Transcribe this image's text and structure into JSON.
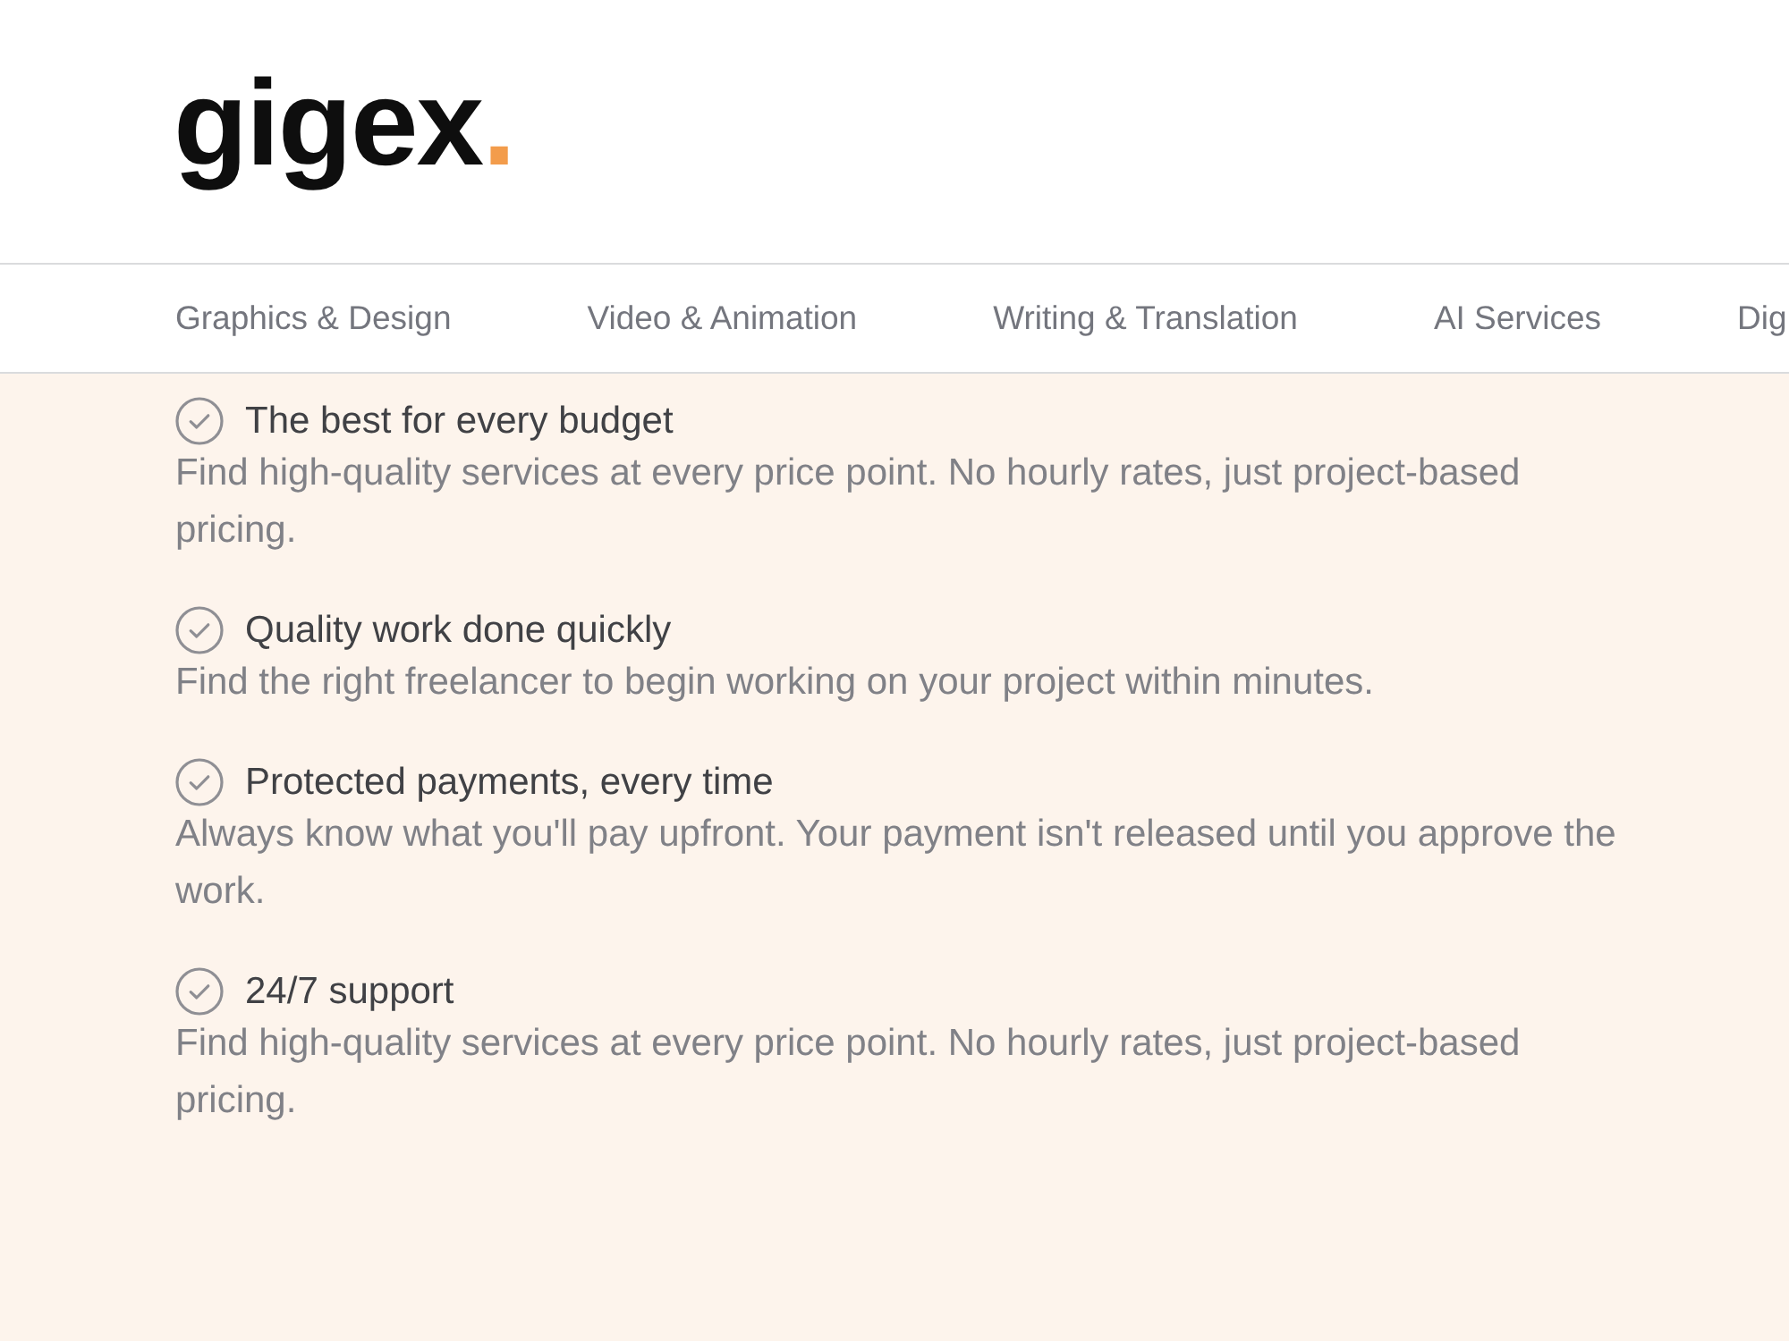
{
  "logo": {
    "text": "gigex",
    "accent": "."
  },
  "nav": {
    "items": [
      "Graphics & Design",
      "Video & Animation",
      "Writing & Translation",
      "AI Services",
      "Dig"
    ]
  },
  "features": [
    {
      "title": "The best for every budget",
      "description": "Find high-quality services at every price point. No hourly rates, just project-based pricing."
    },
    {
      "title": "Quality work done quickly",
      "description": "Find the right freelancer to begin working on your project within minutes."
    },
    {
      "title": "Protected payments, every time",
      "description": "Always know what you'll pay upfront. Your payment isn't released until you approve the work."
    },
    {
      "title": "24/7 support",
      "description": "Find high-quality services at every price point. No hourly rates, just project-based pricing."
    }
  ]
}
